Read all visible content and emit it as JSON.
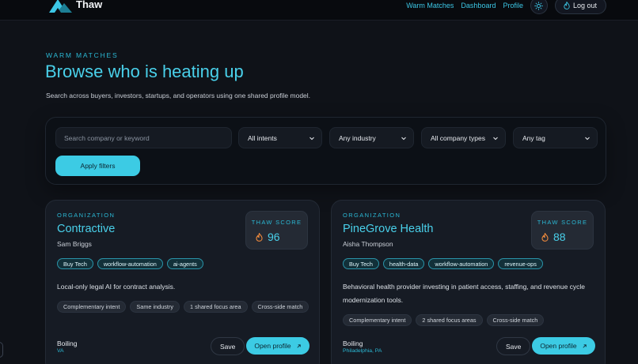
{
  "app": {
    "name": "Thaw"
  },
  "nav": {
    "warm_matches": "Warm Matches",
    "dashboard": "Dashboard",
    "profile": "Profile",
    "logout": "Log out"
  },
  "header": {
    "eyebrow": "WARM MATCHES",
    "title": "Browse who is heating up",
    "subtitle": "Search across buyers, investors, startups, and operators using one shared profile model."
  },
  "filters": {
    "search_placeholder": "Search company or keyword",
    "intent": "All intents",
    "industry": "Any industry",
    "company_type": "All company types",
    "tag": "Any tag",
    "apply": "Apply filters"
  },
  "cards": [
    {
      "kicker": "ORGANIZATION",
      "name": "Contractive",
      "person": "Sam Briggs",
      "score_label": "THAW SCORE",
      "score": "96",
      "tags": [
        "Buy Tech",
        "workflow-automation",
        "ai-agents"
      ],
      "description": "Local-only legal AI for contract analysis.",
      "chips": [
        "Complementary intent",
        "Same industry",
        "1 shared focus area",
        "Cross-side match"
      ],
      "heat": "Boiling",
      "location": "VA",
      "save": "Save",
      "open": "Open profile"
    },
    {
      "kicker": "ORGANIZATION",
      "name": "PineGrove Health",
      "person": "Aisha Thompson",
      "score_label": "THAW SCORE",
      "score": "88",
      "tags": [
        "Buy Tech",
        "health-data",
        "workflow-automation",
        "revenue-ops"
      ],
      "description": "Behavioral health provider investing in patient access, staffing, and revenue cycle modernization tools.",
      "chips": [
        "Complementary intent",
        "2 shared focus areas",
        "Cross-side match"
      ],
      "heat": "Boiling",
      "location": "Philadelphia, PA",
      "save": "Save",
      "open": "Open profile"
    }
  ],
  "colors": {
    "accent": "#3ccbe4",
    "background": "#0f1218",
    "card": "#161b24",
    "flame": "#f08a3c"
  },
  "icons": [
    "logo-mark",
    "sun-icon",
    "flame-icon",
    "chevron-down-icon",
    "arrow-up-right-icon"
  ]
}
